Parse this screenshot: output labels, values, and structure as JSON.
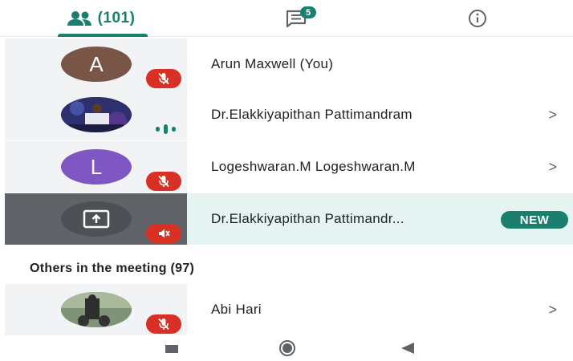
{
  "tabs": {
    "people": {
      "icon": "people-icon",
      "count_label": "(101)"
    },
    "chat": {
      "icon": "chat-icon",
      "badge": "5"
    },
    "info": {
      "icon": "info-icon"
    }
  },
  "participants": [
    {
      "avatar_letter": "A",
      "avatar_color": "#795548",
      "name": "Arun Maxwell (You)",
      "status": "muted",
      "chevron": ""
    },
    {
      "avatar_letter": "",
      "avatar_color": "#3a3f7a",
      "name": "Dr.Elakkiyapithan Pattimandram",
      "status": "speaking",
      "chevron": ">"
    },
    {
      "avatar_letter": "L",
      "avatar_color": "#7e57c2",
      "name": "Logeshwaran.M Logeshwaran.M",
      "status": "muted",
      "chevron": ">"
    },
    {
      "avatar_letter": "",
      "avatar_color": "#5f6368",
      "name": "Dr.Elakkiyapithan Pattimandr...",
      "status": "presenting",
      "badge": "NEW"
    }
  ],
  "others_section": {
    "title": "Others in the meeting (97)",
    "items": [
      {
        "avatar_letter": "",
        "avatar_color": "#6b7d5c",
        "name": "Abi Hari",
        "status": "muted",
        "chevron": ">"
      }
    ]
  },
  "colors": {
    "accent": "#1a7f6e",
    "muted_red": "#d93025"
  },
  "nav": {
    "back": "back-icon",
    "home": "home-icon",
    "recents": "recents-icon"
  }
}
